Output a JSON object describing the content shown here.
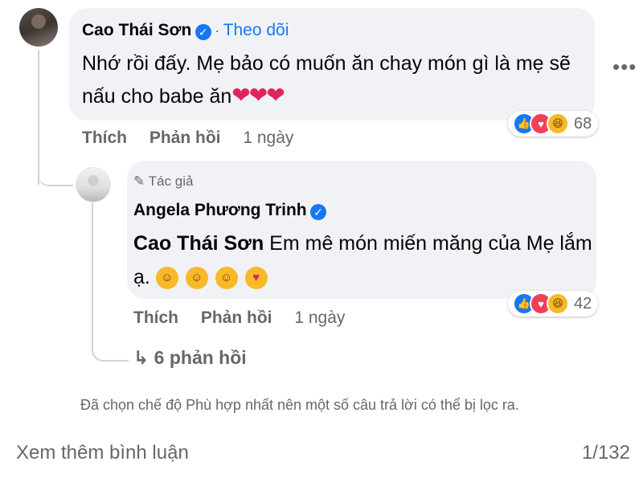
{
  "comment": {
    "author": "Cao Thái Sơn",
    "follow_label": "Theo dõi",
    "separator": "·",
    "text_line1": "Nhớ rồi đấy. Mẹ bảo có muốn ăn chay món gì là mẹ sẽ",
    "text_line2": "nấu cho babe ăn",
    "emoji": "❤❤❤",
    "reaction_count": "68",
    "like_label": "Thích",
    "reply_label": "Phản hồi",
    "time": "1 ngày",
    "more_icon": "more-horizontal-icon"
  },
  "reply": {
    "badge_label": "Tác giả",
    "author": "Angela Phương Trinh",
    "mention": "Cao Thái Sơn",
    "text_line1": " Em mê món miến măng của Mẹ lắm",
    "text_line2": "ạ.",
    "reaction_count": "42",
    "like_label": "Thích",
    "reply_label": "Phản hồi",
    "time": "1 ngày"
  },
  "view_replies_label": "6 phản hồi",
  "filter_note": "Đã chọn chế độ Phù hợp nhất nên một số câu trả lời có thể bị lọc ra.",
  "footer": {
    "more_comments_label": "Xem thêm bình luận",
    "count": "1/132"
  },
  "colors": {
    "accent": "#1877f2",
    "bubble": "#f0f2f5",
    "secondary_text": "#65676b",
    "heart": "#e0245e"
  }
}
